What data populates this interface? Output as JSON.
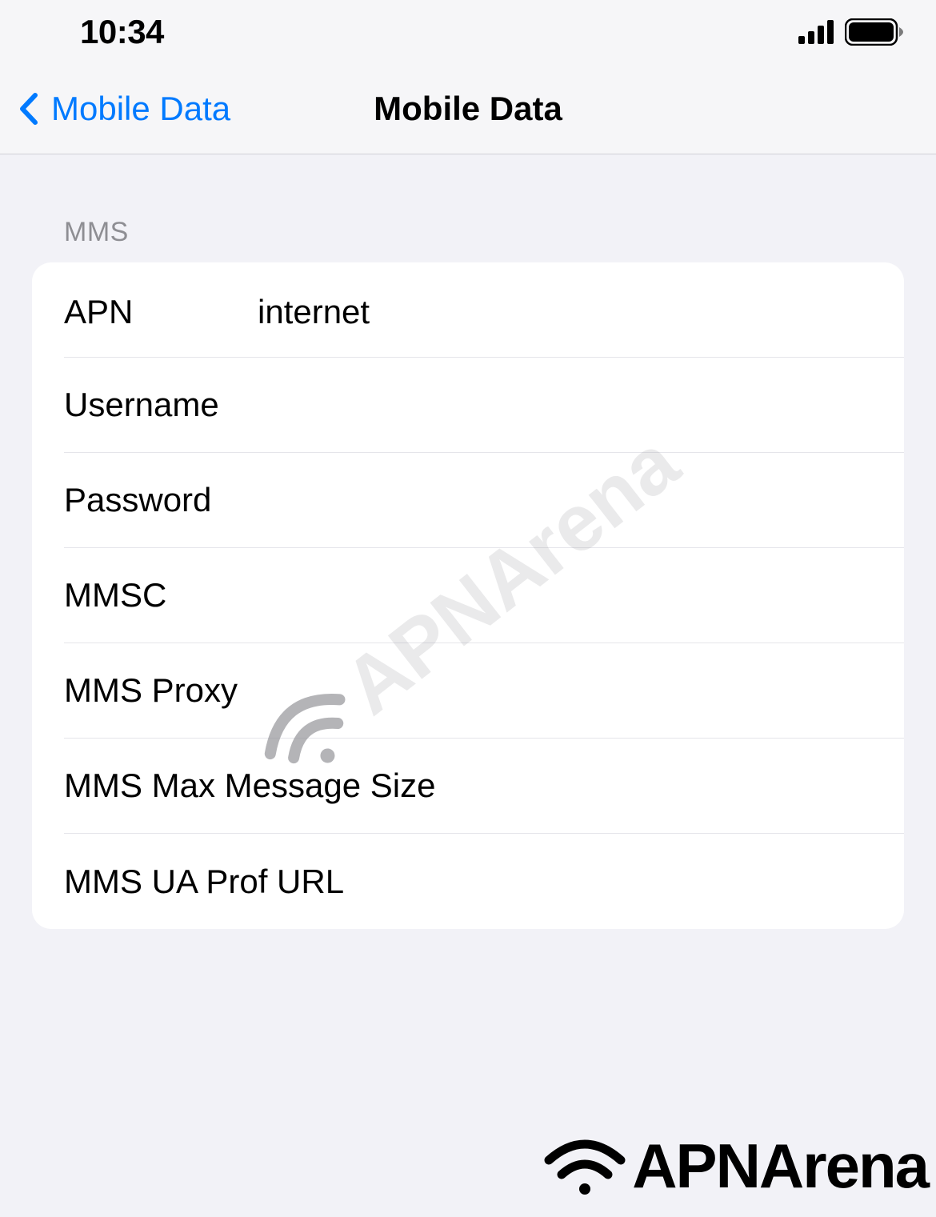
{
  "status_bar": {
    "time": "10:34"
  },
  "nav": {
    "back_label": "Mobile Data",
    "title": "Mobile Data"
  },
  "section": {
    "header": "MMS",
    "rows": [
      {
        "label": "APN",
        "value": "internet"
      },
      {
        "label": "Username",
        "value": ""
      },
      {
        "label": "Password",
        "value": ""
      },
      {
        "label": "MMSC",
        "value": ""
      },
      {
        "label": "MMS Proxy",
        "value": ""
      },
      {
        "label": "MMS Max Message Size",
        "value": ""
      },
      {
        "label": "MMS UA Prof URL",
        "value": ""
      }
    ]
  },
  "watermark": {
    "text": "APNArena"
  },
  "brand": {
    "text": "APNArena"
  }
}
